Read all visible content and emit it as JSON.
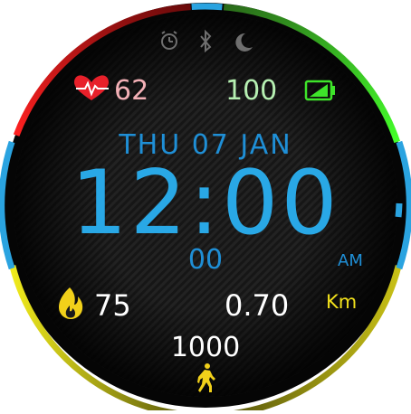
{
  "status_icons": [
    "alarm-icon",
    "bluetooth-icon",
    "moon-icon"
  ],
  "heart_rate": {
    "value": "62",
    "icon": "heart-rate-icon"
  },
  "battery": {
    "value": "100",
    "icon": "battery-icon"
  },
  "date": {
    "text": "THU 07 JAN"
  },
  "time": {
    "main": "12:00",
    "seconds": "00",
    "ampm": "AM"
  },
  "calories": {
    "value": "75",
    "icon": "flame-icon"
  },
  "distance": {
    "value": "0.70",
    "unit": "Km"
  },
  "steps": {
    "value": "1000",
    "icon": "walking-person-icon"
  },
  "colors": {
    "blue": "#29a8e6",
    "green": "#3ee52a",
    "red": "#e01e1e",
    "yellow": "#e8e21c",
    "heart": "#e8202a",
    "pink_text": "#f3b0b6",
    "green_text": "#b6f0b2"
  }
}
